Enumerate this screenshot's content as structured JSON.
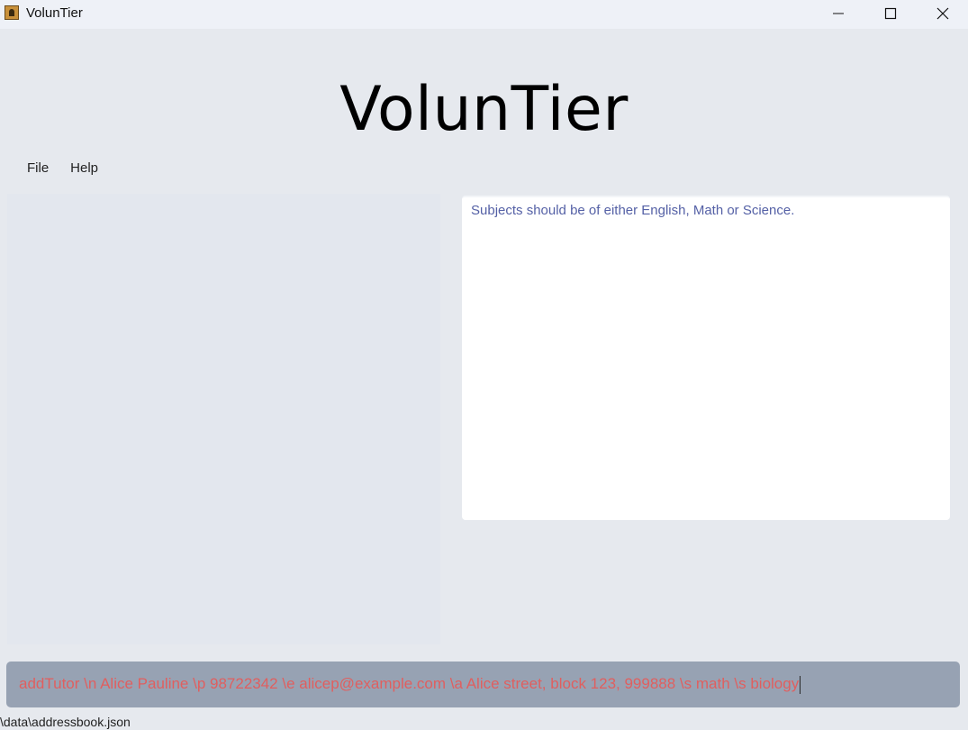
{
  "window": {
    "title": "VolunTier",
    "icon": "app-icon",
    "controls": [
      "minimize-icon",
      "maximize-icon",
      "close-icon"
    ]
  },
  "header": {
    "brand": "VolunTier"
  },
  "menu": {
    "file": "File",
    "help": "Help"
  },
  "result_display": {
    "message": "Subjects should be of either English, Math or Science."
  },
  "command_box": {
    "value": "addTutor \\n Alice Pauline \\p 98722342 \\e alicep@example.com \\a Alice street, block 123, 999888 \\s math \\s biology"
  },
  "status_bar": {
    "path": "\\data\\addressbook.json"
  },
  "colors": {
    "background": "#e6e9ee",
    "command_box": "#97a2b3",
    "error_text": "#e05f5f",
    "result_text": "#5561a6"
  }
}
